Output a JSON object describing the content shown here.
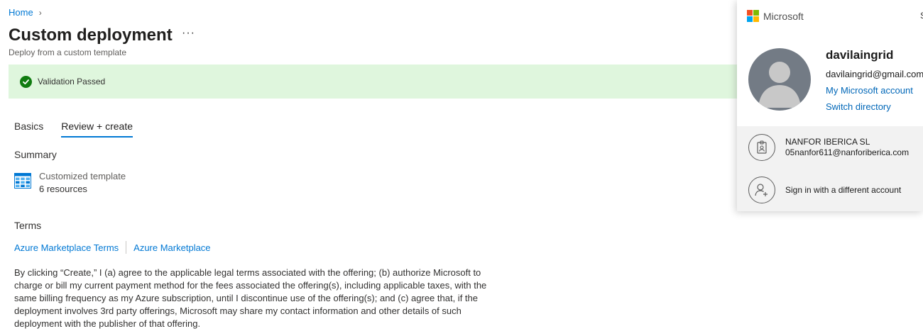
{
  "breadcrumb": {
    "home": "Home",
    "chevron": "›"
  },
  "page": {
    "title": "Custom deployment",
    "more": "···",
    "subtitle": "Deploy from a custom template"
  },
  "validation": {
    "text": "Validation Passed",
    "color": "#107c10",
    "background": "#dff6dd"
  },
  "tabs": [
    {
      "label": "Basics",
      "active": false
    },
    {
      "label": "Review + create",
      "active": true
    }
  ],
  "summary": {
    "heading": "Summary",
    "template_name": "Customized template",
    "resource_count": "6 resources"
  },
  "terms": {
    "heading": "Terms",
    "link1": "Azure Marketplace Terms",
    "link2": "Azure Marketplace",
    "legal": "By clicking “Create,” I (a) agree to the applicable legal terms associated with the offering; (b) authorize Microsoft to charge or bill my current payment method for the fees associated the offering(s), including applicable taxes, with the same billing frequency as my Azure subscription, until I discontinue use of the offering(s); and (c) agree that, if the deployment involves 3rd party offerings, Microsoft may share my contact information and other details of such deployment with the publisher of that offering."
  },
  "account_panel": {
    "brand": "Microsoft",
    "sign_out_fragment": "S",
    "user_name": "davilaingrid",
    "user_email": "davilaingrid@gmail.com",
    "my_account_link": "My Microsoft account",
    "switch_directory_link": "Switch directory",
    "other_account": {
      "org": "NANFOR IBERICA SL",
      "email": "05nanfor611@nanforiberica.com"
    },
    "different_account": "Sign in with a different account"
  },
  "colors": {
    "accent": "#0078d4",
    "ms_red": "#f25022",
    "ms_green": "#7fba00",
    "ms_blue": "#00a4ef",
    "ms_yellow": "#ffb900"
  },
  "icons": {
    "validation": "check-circle-icon",
    "template": "template-grid-icon",
    "avatar": "person-silhouette-icon",
    "org_badge": "id-badge-icon",
    "add_account": "person-add-icon"
  }
}
